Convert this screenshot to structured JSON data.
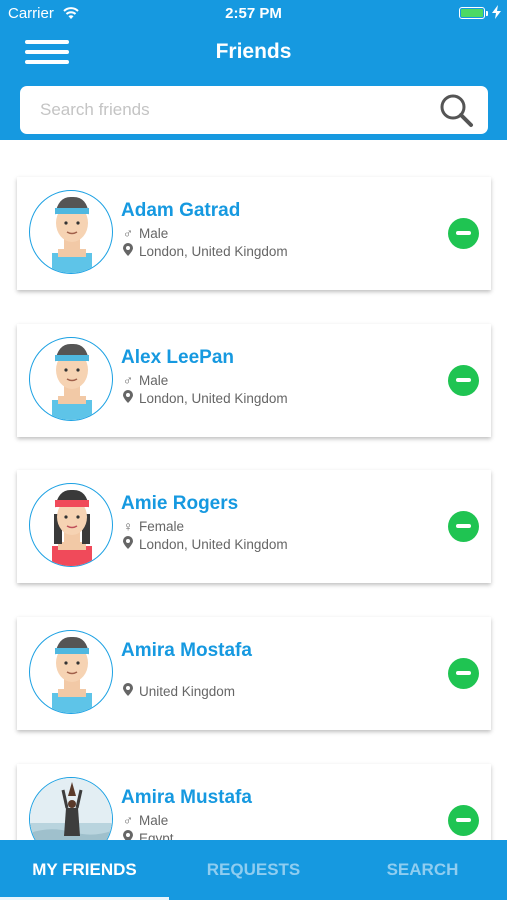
{
  "status_bar": {
    "carrier": "Carrier",
    "time": "2:57 PM"
  },
  "header": {
    "title": "Friends",
    "menu_icon": "hamburger-menu-icon"
  },
  "search": {
    "placeholder": "Search friends",
    "value": "",
    "icon": "search-icon"
  },
  "friends": [
    {
      "name": "Adam Gatrad",
      "gender": "Male",
      "gender_icon": "male-icon",
      "location": "London, United Kingdom",
      "avatar": "male-headband-avatar"
    },
    {
      "name": "Alex LeePan",
      "gender": "Male",
      "gender_icon": "male-icon",
      "location": "London, United Kingdom",
      "avatar": "male-headband-avatar"
    },
    {
      "name": "Amie Rogers",
      "gender": "Female",
      "gender_icon": "female-icon",
      "location": "London, United Kingdom",
      "avatar": "female-headband-avatar"
    },
    {
      "name": "Amira Mostafa",
      "gender": "",
      "gender_icon": "",
      "location": "United Kingdom",
      "avatar": "male-headband-avatar"
    },
    {
      "name": "Amira Mustafa",
      "gender": "Male",
      "gender_icon": "male-icon",
      "location": "Egypt",
      "avatar": "yoga-photo-avatar"
    }
  ],
  "tabs": [
    {
      "label": "MY FRIENDS",
      "active": true
    },
    {
      "label": "REQUESTS",
      "active": false
    },
    {
      "label": "SEARCH",
      "active": false
    }
  ],
  "colors": {
    "primary": "#1699e0",
    "remove": "#1fc452",
    "name": "#1699e0",
    "tab_inactive": "#8fcdf0"
  }
}
